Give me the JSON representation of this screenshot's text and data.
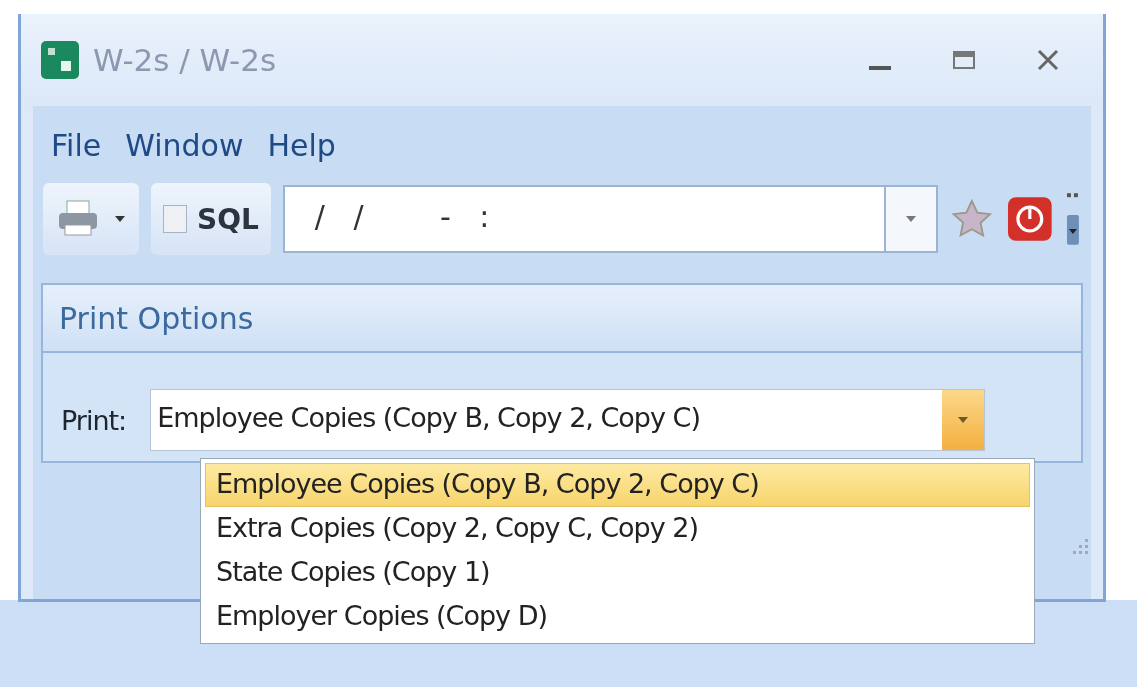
{
  "window": {
    "title": "W-2s / W-2s"
  },
  "menu": [
    "File",
    "Window",
    "Help"
  ],
  "toolbar": {
    "sql": {
      "label": "SQL",
      "checked": false
    },
    "datetime_field": {
      "value": "/   /        -   :"
    }
  },
  "print_options": {
    "title": "Print Options",
    "print_label": "Print:",
    "print_value": "Employee Copies (Copy B, Copy 2, Copy C)",
    "expanded": true,
    "options": [
      {
        "label": "Employee Copies (Copy B, Copy 2, Copy C)",
        "selected": true
      },
      {
        "label": "Extra Copies (Copy 2, Copy C, Copy 2)",
        "selected": false
      },
      {
        "label": "State Copies (Copy 1)",
        "selected": false
      },
      {
        "label": "Employer Copies (Copy D)",
        "selected": false
      }
    ]
  }
}
